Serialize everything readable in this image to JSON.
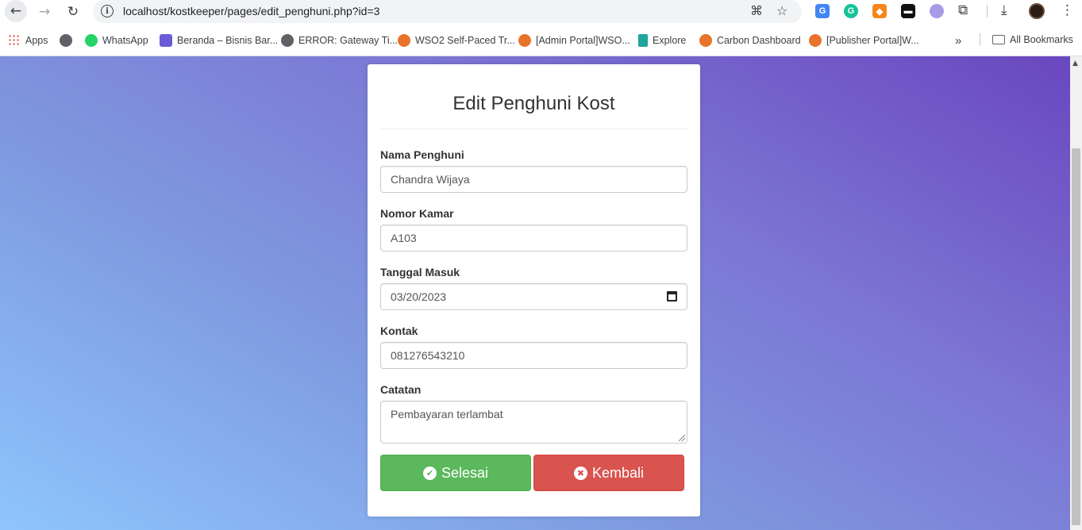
{
  "browser": {
    "url": "localhost/kostkeeper/pages/edit_penghuni.php?id=3",
    "bookmarks": [
      {
        "label": "Apps",
        "color": "#ea4335"
      },
      {
        "label": "",
        "color": "#5f6368"
      },
      {
        "label": "WhatsApp",
        "color": "#25d366"
      },
      {
        "label": "Beranda – Bisnis Bar...",
        "color": "#6b5bd6"
      },
      {
        "label": "ERROR: Gateway Ti...",
        "color": "#5f6368"
      },
      {
        "label": "WSO2 Self-Paced Tr...",
        "color": "#e8732a"
      },
      {
        "label": "[Admin Portal]WSO...",
        "color": "#e8732a"
      },
      {
        "label": "Explore",
        "color": "#1fa59b"
      },
      {
        "label": "Carbon Dashboard",
        "color": "#e8732a"
      },
      {
        "label": "[Publisher Portal]W...",
        "color": "#e8732a"
      }
    ],
    "more_label": "»",
    "all_bookmarks_label": "All Bookmarks"
  },
  "form": {
    "title": "Edit Penghuni Kost",
    "nama_label": "Nama Penghuni",
    "nama_value": "Chandra Wijaya",
    "kamar_label": "Nomor Kamar",
    "kamar_value": "A103",
    "tanggal_label": "Tanggal Masuk",
    "tanggal_value": "03/20/2023",
    "kontak_label": "Kontak",
    "kontak_value": "081276543210",
    "catatan_label": "Catatan",
    "catatan_value": "Pembayaran terlambat",
    "submit_label": "Selesai",
    "back_label": "Kembali"
  },
  "colors": {
    "success": "#5cb85c",
    "danger": "#d9534f",
    "gradient_start": "#8ec5fc",
    "gradient_end": "#6a47bf"
  }
}
